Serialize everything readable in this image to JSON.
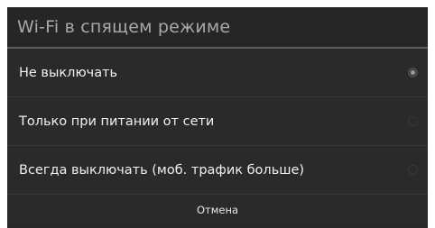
{
  "dialog": {
    "title": "Wi-Fi в спящем режиме",
    "options": [
      {
        "label": "Не выключать",
        "selected": true
      },
      {
        "label": "Только при питании от сети",
        "selected": false
      },
      {
        "label": "Всегда выключать (моб. трафик больше)",
        "selected": false
      }
    ],
    "cancel_label": "Отмена"
  },
  "colors": {
    "dialog_background": "#282828",
    "title_text": "#a8a8a8",
    "option_text": "#f0f0f0",
    "divider": "#5c5c5c"
  },
  "icons": {
    "selected_radio": "radio-checked-icon",
    "unselected_radio": "radio-unchecked-icon"
  }
}
